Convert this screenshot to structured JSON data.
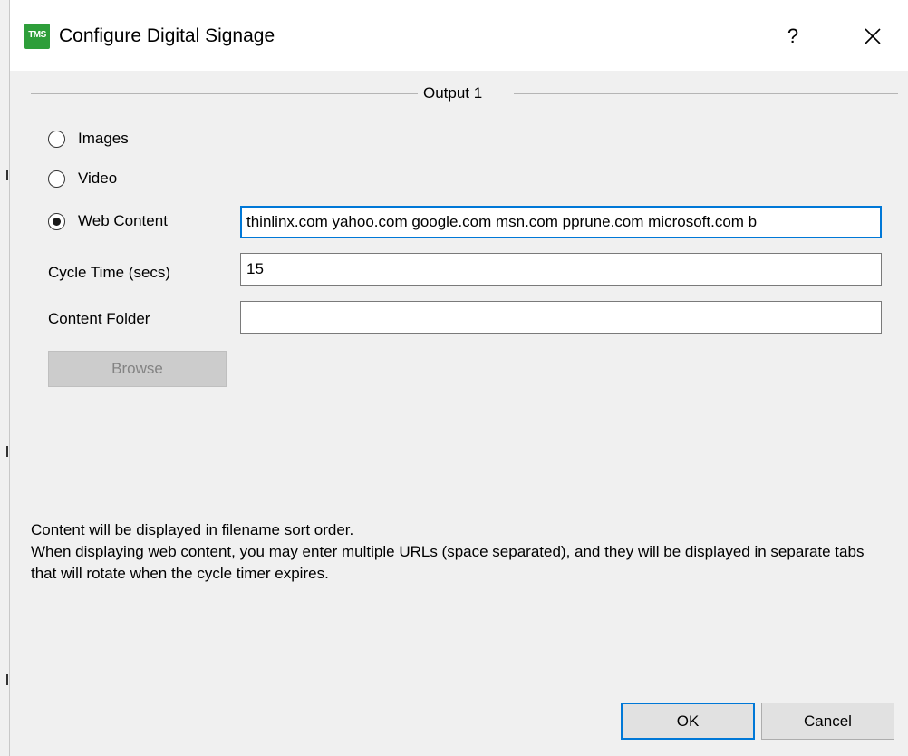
{
  "window": {
    "title": "Configure Digital Signage",
    "icon_text": "TMS",
    "help_label": "?",
    "close_icon": "close-icon"
  },
  "group": {
    "title": "Output 1"
  },
  "content_type": {
    "options": [
      {
        "label": "Images",
        "checked": false
      },
      {
        "label": "Video",
        "checked": false
      },
      {
        "label": "Web Content",
        "checked": true
      }
    ],
    "web_content_value": "thinlinx.com yahoo.com google.com msn.com pprune.com microsoft.com b"
  },
  "cycle_time": {
    "label": "Cycle Time (secs)",
    "value": "15"
  },
  "content_folder": {
    "label": "Content Folder",
    "value": ""
  },
  "browse": {
    "label": "Browse",
    "enabled": false
  },
  "info": {
    "line1": "Content will be displayed in filename sort order.",
    "line2": "When displaying web content, you may enter multiple URLs (space separated), and they will be displayed in separate tabs that will rotate when the cycle timer expires."
  },
  "buttons": {
    "ok_label": "OK",
    "cancel_label": "Cancel"
  },
  "colors": {
    "accent": "#0078d7",
    "icon_green": "#2e9e3a",
    "dialog_bg": "#f0f0f0"
  }
}
